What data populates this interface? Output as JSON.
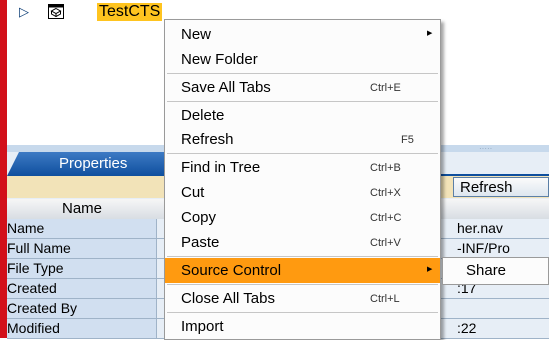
{
  "tree": {
    "expander_glyph": "▷",
    "node_label": "TestCTS",
    "node_icon": "project-icon"
  },
  "panel": {
    "tab_label": "Properties",
    "dots": "·····",
    "refresh_label": "Refresh",
    "column_header": "Name",
    "rows": [
      {
        "name": "Name",
        "value": "her.nav"
      },
      {
        "name": "Full Name",
        "value": "-INF/Pro"
      },
      {
        "name": "File Type",
        "value": ""
      },
      {
        "name": "Created",
        "value": ":17"
      },
      {
        "name": "Created By",
        "value": ""
      },
      {
        "name": "Modified",
        "value": ":22"
      }
    ]
  },
  "menu": {
    "items": [
      {
        "label": "New",
        "shortcut": "",
        "submenu": true
      },
      {
        "label": "New Folder",
        "shortcut": "",
        "submenu": false
      },
      {
        "label": "Save All Tabs",
        "shortcut": "Ctrl+E",
        "submenu": false
      },
      {
        "label": "Delete",
        "shortcut": "",
        "submenu": false
      },
      {
        "label": "Refresh",
        "shortcut": "F5",
        "submenu": false
      },
      {
        "label": "Find in Tree",
        "shortcut": "Ctrl+B",
        "submenu": false
      },
      {
        "label": "Cut",
        "shortcut": "Ctrl+X",
        "submenu": false
      },
      {
        "label": "Copy",
        "shortcut": "Ctrl+C",
        "submenu": false
      },
      {
        "label": "Paste",
        "shortcut": "Ctrl+V",
        "submenu": false
      },
      {
        "label": "Source Control",
        "shortcut": "",
        "submenu": true,
        "selected": true
      },
      {
        "label": "Close All Tabs",
        "shortcut": "Ctrl+L",
        "submenu": false
      },
      {
        "label": "Import",
        "shortcut": "",
        "submenu": false
      }
    ],
    "submenu_arrow": "▶"
  },
  "submenu": {
    "items": [
      {
        "label": "Share"
      }
    ]
  },
  "colors": {
    "accent_red": "#d2101a",
    "selection_orange": "#ff9a10",
    "node_highlight": "#ffc41f",
    "tab_blue": "#0f4f9e"
  }
}
